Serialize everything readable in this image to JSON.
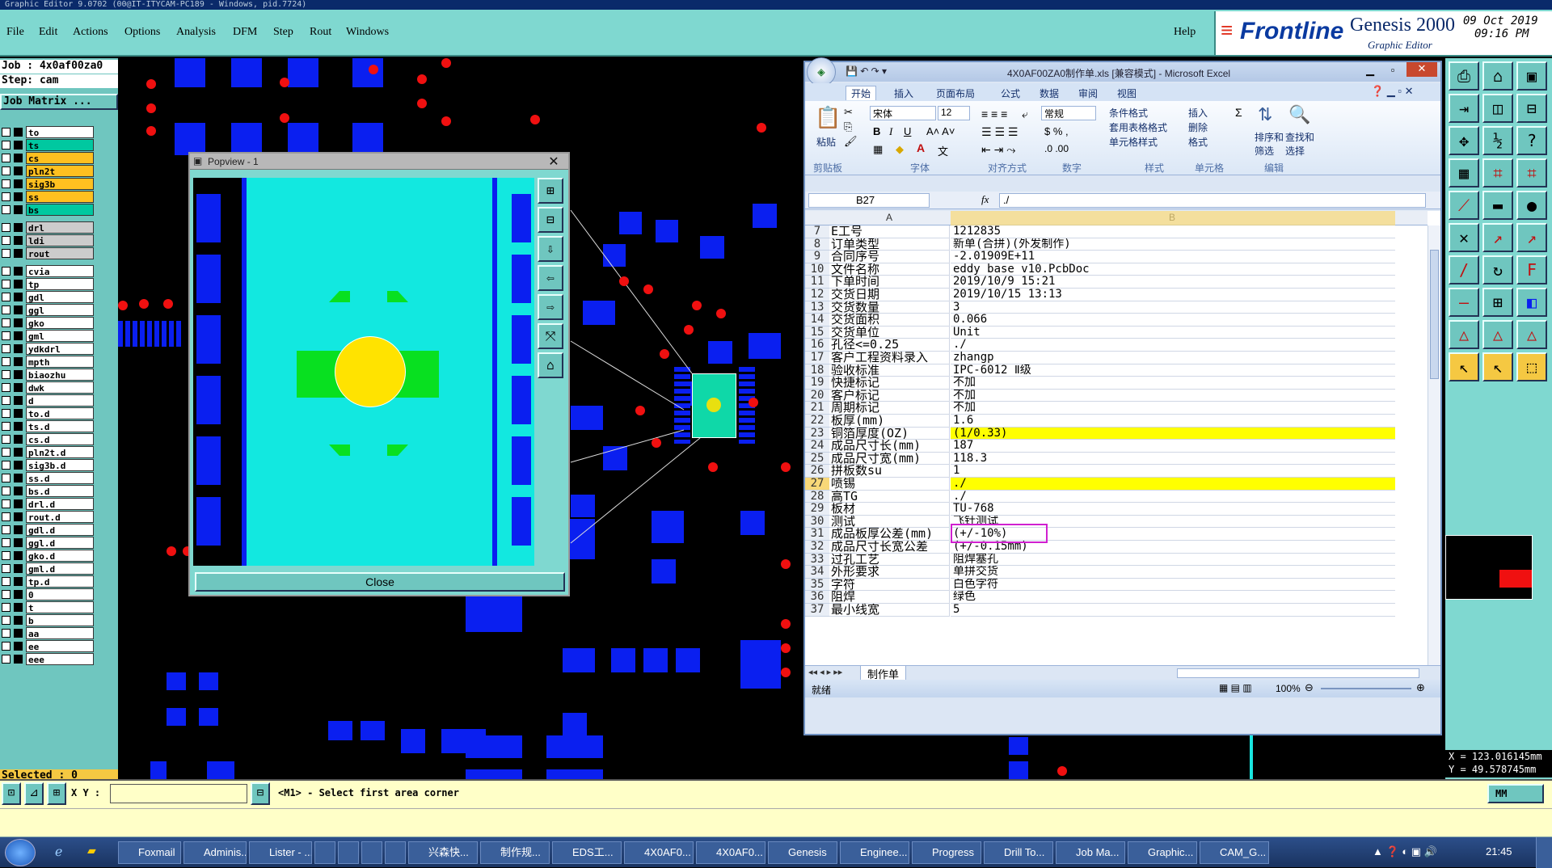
{
  "window_title": "Graphic Editor 9.0702 (00@IT-ITYCAM-PC189 - Windows, pid.7724)",
  "menu": {
    "items": [
      "File",
      "Edit",
      "Actions",
      "Options",
      "Analysis",
      "DFM",
      "Step",
      "Rout",
      "Windows"
    ],
    "help": "Help"
  },
  "brand": {
    "name": "Frontline",
    "product": "Genesis 2000",
    "subtitle": "Graphic Editor",
    "date": "09 Oct 2019",
    "time": "09:16 PM"
  },
  "job": {
    "job_line": "Job : 4x0af00za0",
    "step_line": "Step: cam",
    "matrix_btn": "Job Matrix ..."
  },
  "layers": [
    {
      "name": "to",
      "color": "#ffffff"
    },
    {
      "name": "ts",
      "color": "#00c8a0"
    },
    {
      "name": "cs",
      "color": "#ffc020"
    },
    {
      "name": "pln2t",
      "color": "#ffc020"
    },
    {
      "name": "sig3b",
      "color": "#ffc020"
    },
    {
      "name": "ss",
      "color": "#ffc020"
    },
    {
      "name": "bs",
      "color": "#00c8a0"
    },
    {
      "name": "drl",
      "color": "#cccccc"
    },
    {
      "name": "ldi",
      "color": "#cccccc"
    },
    {
      "name": "rout",
      "color": "#cccccc"
    },
    {
      "name": "cvia",
      "color": "#ffffff"
    },
    {
      "name": "tp",
      "color": "#ffffff"
    },
    {
      "name": "gdl",
      "color": "#ffffff"
    },
    {
      "name": "ggl",
      "color": "#ffffff"
    },
    {
      "name": "gko",
      "color": "#ffffff"
    },
    {
      "name": "gml",
      "color": "#ffffff"
    },
    {
      "name": "ydkdrl",
      "color": "#ffffff"
    },
    {
      "name": "mpth",
      "color": "#ffffff"
    },
    {
      "name": "biaozhu",
      "color": "#ffffff"
    },
    {
      "name": "dwk",
      "color": "#ffffff"
    },
    {
      "name": "d",
      "color": "#ffffff"
    },
    {
      "name": "to.d",
      "color": "#ffffff"
    },
    {
      "name": "ts.d",
      "color": "#ffffff"
    },
    {
      "name": "cs.d",
      "color": "#ffffff"
    },
    {
      "name": "pln2t.d",
      "color": "#ffffff"
    },
    {
      "name": "sig3b.d",
      "color": "#ffffff"
    },
    {
      "name": "ss.d",
      "color": "#ffffff"
    },
    {
      "name": "bs.d",
      "color": "#ffffff"
    },
    {
      "name": "drl.d",
      "color": "#ffffff"
    },
    {
      "name": "rout.d",
      "color": "#ffffff"
    },
    {
      "name": "gdl.d",
      "color": "#ffffff"
    },
    {
      "name": "ggl.d",
      "color": "#ffffff"
    },
    {
      "name": "gko.d",
      "color": "#ffffff"
    },
    {
      "name": "gml.d",
      "color": "#ffffff"
    },
    {
      "name": "tp.d",
      "color": "#ffffff"
    },
    {
      "name": "0",
      "color": "#ffffff"
    },
    {
      "name": "t",
      "color": "#ffffff"
    },
    {
      "name": "b",
      "color": "#ffffff"
    },
    {
      "name": "aa",
      "color": "#ffffff"
    },
    {
      "name": "ee",
      "color": "#ffffff"
    },
    {
      "name": "eee",
      "color": "#ffffff"
    }
  ],
  "selected": "Selected : 0",
  "popview": {
    "title": "Popview - 1",
    "close": "Close"
  },
  "excel": {
    "title": "4X0AF00ZA0制作单.xls [兼容模式] - Microsoft Excel",
    "tabs": [
      "开始",
      "插入",
      "页面布局",
      "公式",
      "数据",
      "审阅",
      "视图"
    ],
    "font_name": "宋体",
    "font_size": "12",
    "number_format": "常规",
    "groups": [
      "剪贴板",
      "字体",
      "对齐方式",
      "数字",
      "样式",
      "单元格",
      "编辑"
    ],
    "paste": "粘贴",
    "style_btns": [
      "条件格式",
      "套用表格格式",
      "单元格样式"
    ],
    "cell_btns": [
      "插入",
      "删除",
      "格式"
    ],
    "edit_btns": [
      "排序和筛选",
      "查找和选择"
    ],
    "namebox": "B27",
    "formula": "./",
    "col_a": "A",
    "col_b": "B",
    "rows": [
      {
        "n": "7",
        "a": "E工号",
        "b": "1212835"
      },
      {
        "n": "8",
        "a": "订单类型",
        "b": "新单(合拼)(外发制作)"
      },
      {
        "n": "9",
        "a": "合同序号",
        "b": "-2.01909E+11"
      },
      {
        "n": "10",
        "a": "文件名称",
        "b": "eddy_base_v10.PcbDoc"
      },
      {
        "n": "11",
        "a": "下单时间",
        "b": "2019/10/9 15:21"
      },
      {
        "n": "12",
        "a": "交货日期",
        "b": "2019/10/15 13:13"
      },
      {
        "n": "13",
        "a": "交货数量",
        "b": "3"
      },
      {
        "n": "14",
        "a": "交货面积",
        "b": "0.066"
      },
      {
        "n": "15",
        "a": "交货单位",
        "b": "Unit"
      },
      {
        "n": "16",
        "a": "孔径<=0.25",
        "b": "./"
      },
      {
        "n": "17",
        "a": "客户工程资料录入",
        "b": "zhangp"
      },
      {
        "n": "18",
        "a": "验收标准",
        "b": "IPC-6012 Ⅱ级"
      },
      {
        "n": "19",
        "a": "快捷标记",
        "b": "不加"
      },
      {
        "n": "20",
        "a": "客户标记",
        "b": "不加"
      },
      {
        "n": "21",
        "a": "周期标记",
        "b": "不加"
      },
      {
        "n": "22",
        "a": "板厚(mm)",
        "b": "1.6"
      },
      {
        "n": "23",
        "a": "铜箔厚度(OZ)",
        "b": " (1/0.33)"
      },
      {
        "n": "24",
        "a": "成品尺寸长(mm)",
        "b": "187"
      },
      {
        "n": "25",
        "a": "成品尺寸宽(mm)",
        "b": "118.3"
      },
      {
        "n": "26",
        "a": "拼板数su",
        "b": "1"
      },
      {
        "n": "27",
        "a": "喷锡",
        "b": "./"
      },
      {
        "n": "28",
        "a": "高TG",
        "b": "./"
      },
      {
        "n": "29",
        "a": "板材",
        "b": "TU-768"
      },
      {
        "n": "30",
        "a": "测试",
        "b": "飞针测试"
      },
      {
        "n": "31",
        "a": "成品板厚公差(mm)",
        "b": "(+/-10%)"
      },
      {
        "n": "32",
        "a": "成品尺寸长宽公差",
        "b": "(+/-0.15mm)"
      },
      {
        "n": "33",
        "a": "过孔工艺",
        "b": "阻焊塞孔"
      },
      {
        "n": "34",
        "a": "外形要求",
        "b": "单拼交货"
      },
      {
        "n": "35",
        "a": "字符",
        "b": "白色字符"
      },
      {
        "n": "36",
        "a": "阻焊",
        "b": "绿色"
      },
      {
        "n": "37",
        "a": "最小线宽",
        "b": "5"
      }
    ],
    "sheet_tab": "制作单",
    "status": "就绪",
    "zoom": "100%"
  },
  "coords": {
    "x": "X = 123.016145mm",
    "y": "Y =  49.578745mm"
  },
  "status": {
    "xy_label": "X Y :",
    "prompt": "<M1> - Select first area corner",
    "units": "MM"
  },
  "taskbar": {
    "items": [
      "Foxmail",
      "Adminis...",
      "Lister - ...",
      "",
      "",
      "",
      "",
      "兴森快...",
      "制作规...",
      "EDS工...",
      "4X0AF0...",
      "4X0AF0...",
      "Genesis",
      "Enginee...",
      "Progress",
      "Drill To...",
      "Job Ma...",
      "Graphic...",
      "CAM_G..."
    ],
    "clock": "21:45"
  }
}
